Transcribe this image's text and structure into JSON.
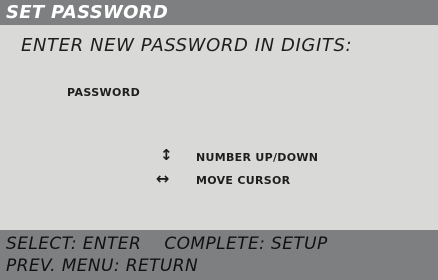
{
  "header": {
    "title": "SET PASSWORD"
  },
  "prompt": {
    "text": "ENTER NEW PASSWORD IN DIGITS:"
  },
  "field": {
    "label": "PASSWORD"
  },
  "hints": [
    {
      "icon": "up-down-arrows-icon",
      "glyph": "↕",
      "text": "NUMBER UP/DOWN"
    },
    {
      "icon": "left-right-arrows-icon",
      "glyph": "↔",
      "text": "MOVE CURSOR"
    }
  ],
  "footer": {
    "line1": "SELECT: ENTER    COMPLETE: SETUP",
    "line2": "PREV. MENU: RETURN"
  },
  "colors": {
    "background": "#d9d9d7",
    "bar": "#7e7f80",
    "title_text": "#ffffff",
    "body_text": "#1e1e1e"
  }
}
